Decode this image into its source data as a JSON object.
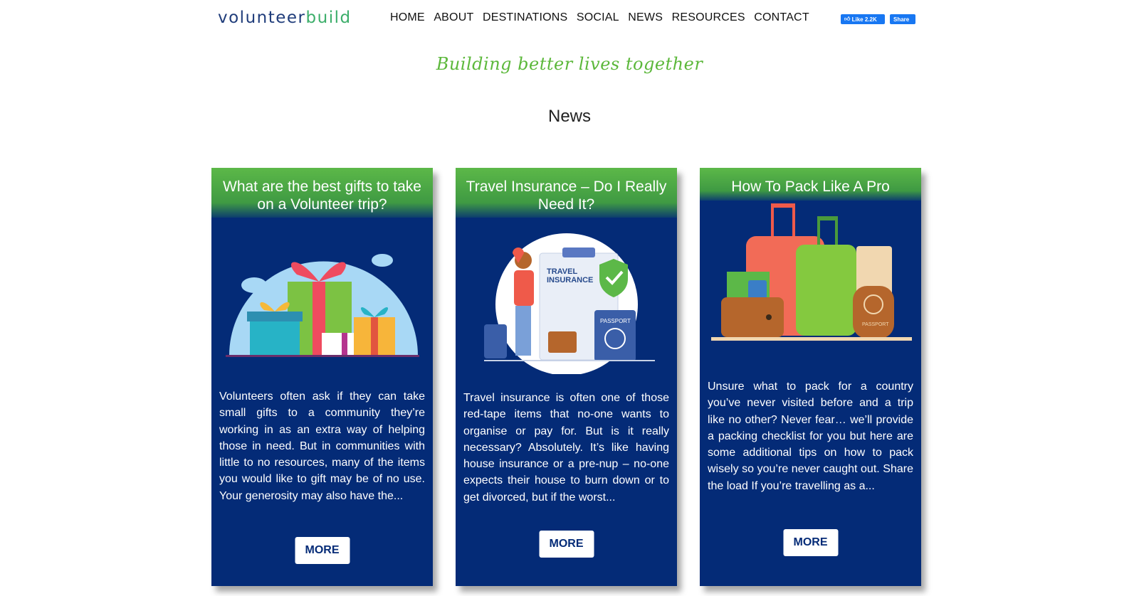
{
  "logo": {
    "part1": "volunteer",
    "part2": "build"
  },
  "nav": [
    "HOME",
    "ABOUT",
    "DESTINATIONS",
    "SOCIAL",
    "NEWS",
    "RESOURCES",
    "CONTACT"
  ],
  "facebook": {
    "like_label": "Like 2.2K",
    "share_label": "Share"
  },
  "tagline": "Building better lives together",
  "page_title": "News",
  "cards": [
    {
      "title": "What are the best gifts to take on a Volunteer trip?",
      "excerpt": "Volunteers often ask if they can take small gifts to a community they’re working in as an extra way of helping those in need. But in communities with little to no resources, many of the items you would like to gift may be of no use. Your generosity may also have the...",
      "button": "MORE"
    },
    {
      "title": "Travel Insurance – Do I Really Need It?",
      "excerpt": "Travel insurance is often one of those red-tape items that no-one wants to organise or pay for. But is it really necessary? Absolutely. It’s like having house insurance or a pre-nup – no-one expects their house to burn down or to get divorced, but if the worst...",
      "button": "MORE",
      "illustration_text": {
        "line1": "TRAVEL",
        "line2": "INSURANCE",
        "passport": "PASSPORT"
      }
    },
    {
      "title": "How To Pack Like A Pro",
      "excerpt": "Unsure what to pack for a country you’ve never visited before and a trip like no other? Never fear… we’ll provide a packing checklist for you but here are some additional tips on how to pack wisely so you’re never caught out. Share the load If you’re travelling as a...",
      "button": "MORE",
      "illustration_text": {
        "passport": "PASSPORT"
      }
    }
  ],
  "colors": {
    "card_bg": "#042b77",
    "header_green": "#5cb848",
    "tagline_green": "#5cb83b",
    "logo_blue": "#1f3c7a"
  }
}
